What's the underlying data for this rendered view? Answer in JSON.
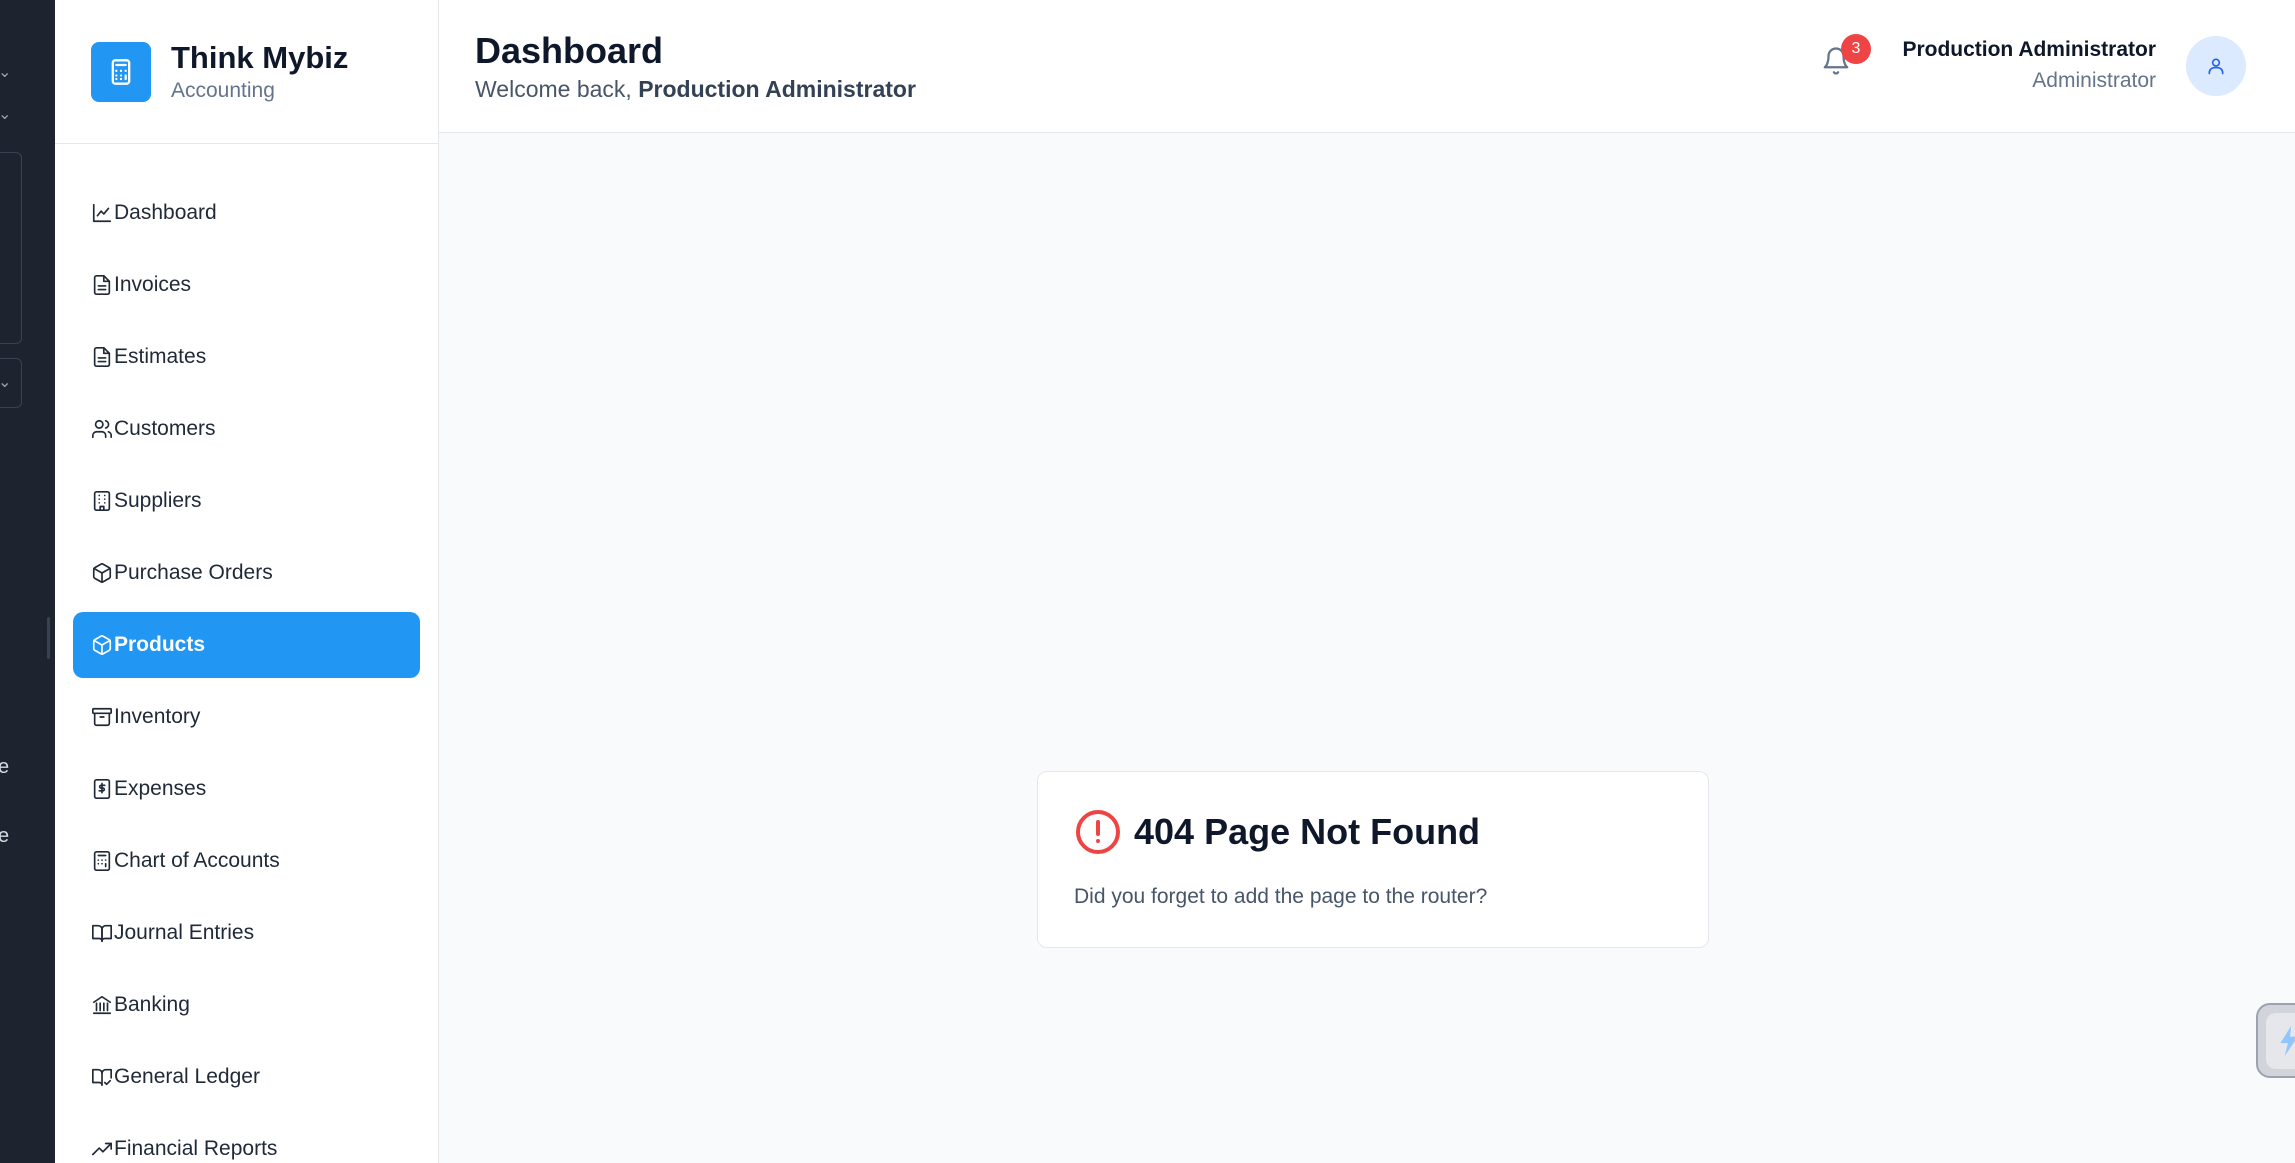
{
  "brand": {
    "title": "Think Mybiz",
    "subtitle": "Accounting"
  },
  "sidebar": {
    "items": [
      {
        "label": "Dashboard",
        "icon": "chart-line-icon",
        "active": false
      },
      {
        "label": "Invoices",
        "icon": "file-text-icon",
        "active": false
      },
      {
        "label": "Estimates",
        "icon": "file-text-icon",
        "active": false
      },
      {
        "label": "Customers",
        "icon": "users-icon",
        "active": false
      },
      {
        "label": "Suppliers",
        "icon": "building-icon",
        "active": false
      },
      {
        "label": "Purchase Orders",
        "icon": "package-icon",
        "active": false
      },
      {
        "label": "Products",
        "icon": "package-icon",
        "active": true
      },
      {
        "label": "Inventory",
        "icon": "archive-icon",
        "active": false
      },
      {
        "label": "Expenses",
        "icon": "dollar-receipt-icon",
        "active": false
      },
      {
        "label": "Chart of Accounts",
        "icon": "calculator-icon",
        "active": false
      },
      {
        "label": "Journal Entries",
        "icon": "book-open-icon",
        "active": false
      },
      {
        "label": "Banking",
        "icon": "bank-icon",
        "active": false
      },
      {
        "label": "General Ledger",
        "icon": "book-check-icon",
        "active": false
      },
      {
        "label": "Financial Reports",
        "icon": "trending-up-icon",
        "active": false
      }
    ]
  },
  "header": {
    "title": "Dashboard",
    "welcome_prefix": "Welcome back,",
    "welcome_name": "Production Administrator",
    "notification_count": "3",
    "user_name": "Production Administrator",
    "user_role": "Administrator"
  },
  "error_card": {
    "title": "404 Page Not Found",
    "message": "Did you forget to add the page to the router?"
  },
  "left_strip": {
    "letters": [
      "e",
      "e"
    ]
  },
  "colors": {
    "accent": "#2196f3",
    "danger": "#ef4444",
    "sidebar_bg": "#ffffff",
    "main_bg": "#f8fafc",
    "dark_panel": "#1e2330"
  }
}
